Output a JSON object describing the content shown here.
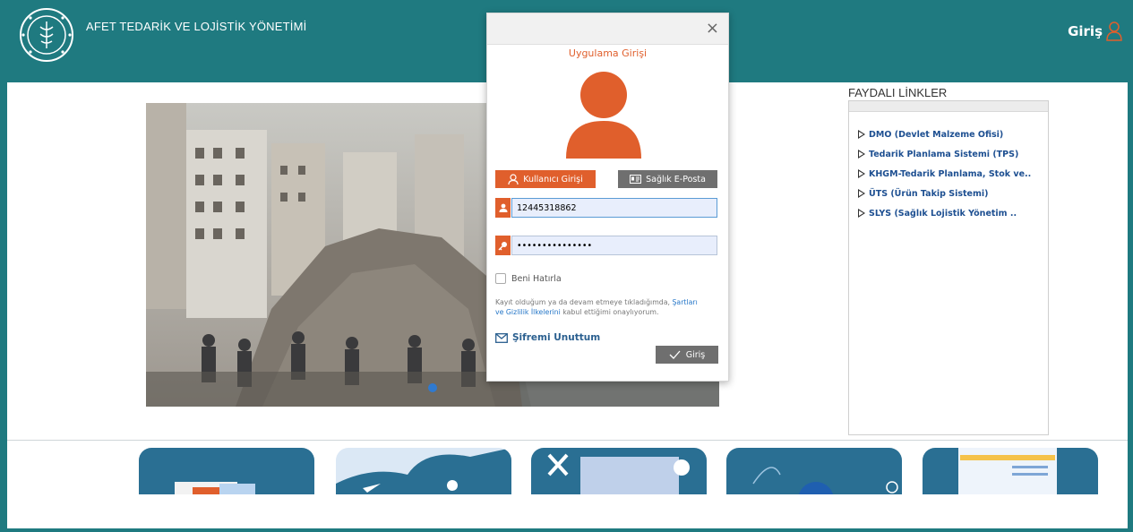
{
  "header": {
    "title": "AFET TEDARİK VE LOJİSTİK YÖNETİMİ",
    "login_label": "Giriş"
  },
  "links": {
    "title": "FAYDALI LİNKLER",
    "items": [
      "DMO (Devlet Malzeme Ofisi)",
      "Tedarik Planlama Sistemi (TPS)",
      "KHGM-Tedarik Planlama, Stok ve..",
      "ÜTS (Ürün Takip Sistemi)",
      "SLYS (Sağlık Lojistik Yönetim .."
    ]
  },
  "modal": {
    "title": "Uygulama Girişi",
    "tab_user": "Kullanıcı Girişi",
    "tab_email": "Sağlık E-Posta",
    "username": "12445318862",
    "password": "•••••••••••••••",
    "remember": "Beni Hatırla",
    "terms_pre": "Kayıt olduğum ya da devam etmeye tıkladığımda, ",
    "terms_link1": "Şartları",
    "terms_mid": "ve ",
    "terms_link2": "Gizlilik İlkelerini",
    "terms_post": " kabul ettiğimi onaylıyorum.",
    "forgot": "Şifremi Unuttum",
    "submit": "Giriş",
    "close": "×"
  },
  "colors": {
    "brand": "#1f7a80",
    "accent": "#e05f2c",
    "link": "#1d4f91"
  },
  "icons": [
    "ministry-logo",
    "user-outline-icon",
    "user-avatar-icon",
    "id-card-icon",
    "user-icon",
    "key-icon",
    "envelope-icon",
    "check-icon",
    "triangle-right-icon"
  ]
}
